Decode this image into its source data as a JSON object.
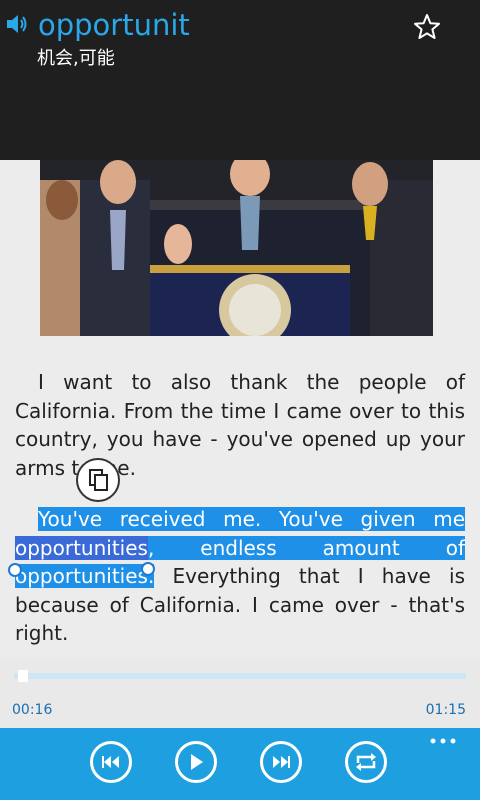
{
  "header": {
    "word": "opportunit",
    "meaning": "机会,可能"
  },
  "icons": {
    "speaker": "speaker-icon",
    "favorite": "star-icon",
    "copy": "copy-icon",
    "prev": "previous-icon",
    "play": "play-icon",
    "next": "next-icon",
    "repeat": "repeat-icon",
    "more": "more-icon"
  },
  "transcript": {
    "para1": "I want to also thank the people of California. From the time I came over to this country, you have - you've opened up your arms to me.",
    "para2_sel_a": "You've received me. You've given me ",
    "para2_sel_word1": "opportunities",
    "para2_sel_b": ", endless amount of ",
    "para2_sel_word2": "opportunities.",
    "para2_rest": " Everything that I have is because of California. I came over - that's right."
  },
  "player": {
    "current_time": "00:16",
    "total_time": "01:15",
    "progress": 0.02
  },
  "colors": {
    "accent": "#1e9fe0",
    "header_bg": "#1f1f1f",
    "word": "#29a7e8",
    "selection": "#1e90e8"
  }
}
